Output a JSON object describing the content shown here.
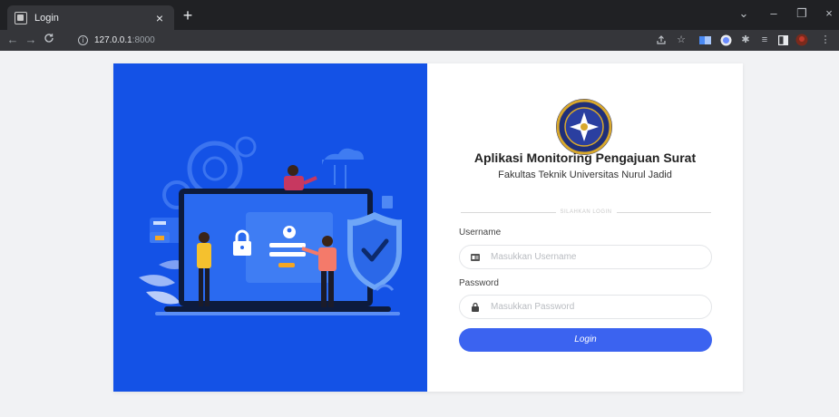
{
  "browser": {
    "tab_title": "Login",
    "tab_close": "×",
    "new_tab": "+",
    "url_host": "127.0.0.1",
    "url_port": ":8000",
    "window_controls": {
      "minimize": "–",
      "maximize": "❐",
      "close": "×",
      "tab_search": "⌄"
    }
  },
  "illustration": {
    "icon": "security-login-illustration",
    "colors": {
      "background": "#1452e6",
      "shield": "#2f7bf0",
      "accent": "#f5a623"
    }
  },
  "login": {
    "logo_icon": "university-seal-icon",
    "app_title": "Aplikasi Monitoring Pengajuan Surat",
    "app_subtitle": "Fakultas Teknik Universitas Nurul Jadid",
    "divider_text": "SILAHKAN LOGIN",
    "username": {
      "label": "Username",
      "placeholder": "Masukkan Username",
      "value": "",
      "icon": "id-card-icon"
    },
    "password": {
      "label": "Password",
      "placeholder": "Masukkan Password",
      "value": "",
      "icon": "lock-icon"
    },
    "submit_label": "Login",
    "colors": {
      "button": "#3b63f0",
      "card": "#ffffff",
      "page": "#f1f2f4"
    }
  }
}
